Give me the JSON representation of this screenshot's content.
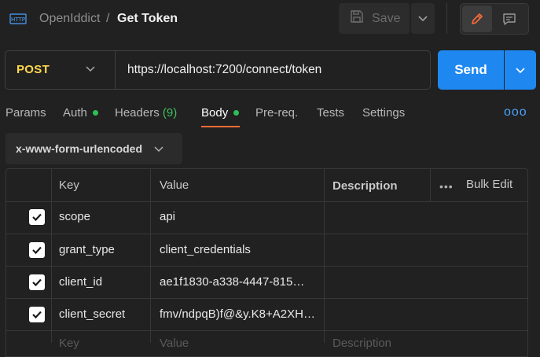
{
  "header": {
    "app_icon": "http-icon",
    "app_icon_label": "HTTP",
    "collection": "OpenIddict",
    "separator": "/",
    "title": "Get Token",
    "save_label": "Save",
    "save_icon": "save-icon"
  },
  "request": {
    "method": "POST",
    "url": "https://localhost:7200/connect/token",
    "send_label": "Send",
    "method_color": "#ffd84d",
    "send_color": "#1f88f0"
  },
  "tabs": [
    {
      "label": "Params",
      "dot": false
    },
    {
      "label": "Auth",
      "dot": true
    },
    {
      "label": "Headers",
      "count": "(9)"
    },
    {
      "label": "Body",
      "dot": true,
      "active": true
    },
    {
      "label": "Pre-req."
    },
    {
      "label": "Tests"
    },
    {
      "label": "Settings"
    }
  ],
  "more_label": "ooo",
  "body_type": "x-www-form-urlencoded",
  "table": {
    "headers": {
      "key": "Key",
      "value": "Value",
      "description": "Description",
      "bulk_edit": "Bulk Edit",
      "more": "•••"
    },
    "rows": [
      {
        "checked": true,
        "key": "scope",
        "value": "api"
      },
      {
        "checked": true,
        "key": "grant_type",
        "value": "client_credentials"
      },
      {
        "checked": true,
        "key": "client_id",
        "value": "ae1f1830-a338-4447-815…"
      },
      {
        "checked": true,
        "key": "client_secret",
        "value": "fmv/ndpqB)f@&y.K8+A2XH…"
      }
    ],
    "placeholder": {
      "key": "Key",
      "value": "Value",
      "description": "Description"
    }
  },
  "colors": {
    "accent_tab": "#ff6c37",
    "dot": "#2fbf58",
    "background": "#212121"
  }
}
